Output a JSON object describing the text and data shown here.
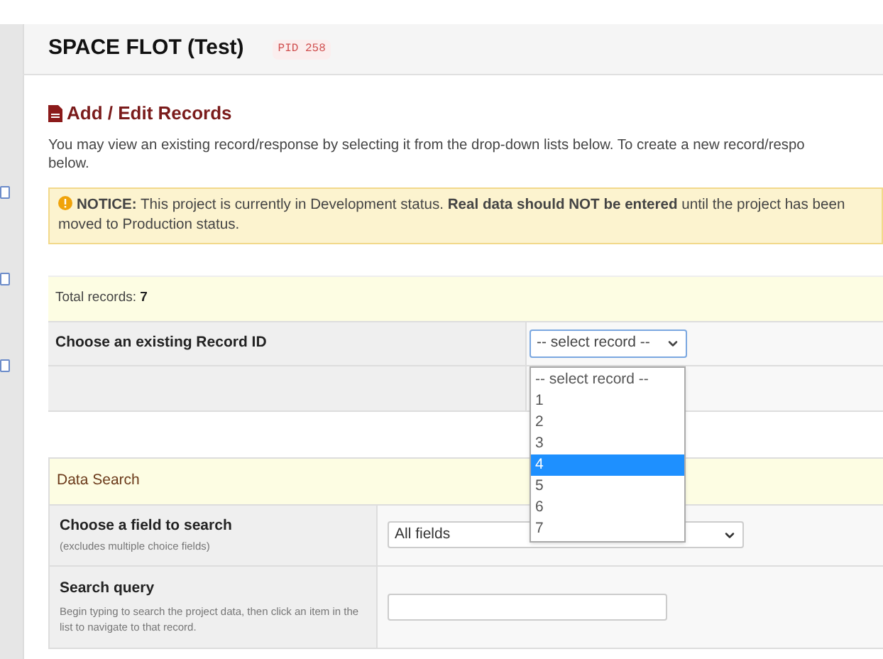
{
  "header": {
    "title": "SPACE FLOT (Test)",
    "pid": "PID 258"
  },
  "section": {
    "title": "Add / Edit Records",
    "intro_lines": [
      "You may view an existing record/response by selecting it from the drop-down lists below. To create a new record/respo",
      "below."
    ]
  },
  "notice": {
    "text": "**NOTICE:** This project is currently in Development status. **Real data should NOT be entered** until the project has been moved to Production status."
  },
  "records": {
    "total_label": "Total records:",
    "total": "7",
    "choose_label": "Choose an existing Record ID",
    "select_value": "-- select record --",
    "options": [
      {
        "label": "-- select record --",
        "selected": false
      },
      {
        "label": "1",
        "selected": false
      },
      {
        "label": "2",
        "selected": false
      },
      {
        "label": "3",
        "selected": false
      },
      {
        "label": "4",
        "selected": true
      },
      {
        "label": "5",
        "selected": false
      },
      {
        "label": "6",
        "selected": false
      },
      {
        "label": "7",
        "selected": false
      }
    ]
  },
  "search": {
    "title": "Data Search",
    "field_label": "Choose a field to search",
    "field_hint": "(excludes multiple choice fields)",
    "field_value": "All fields",
    "query_label": "Search query",
    "query_hint": "Begin typing to search the project data, then click an item in the list to navigate to that record."
  }
}
